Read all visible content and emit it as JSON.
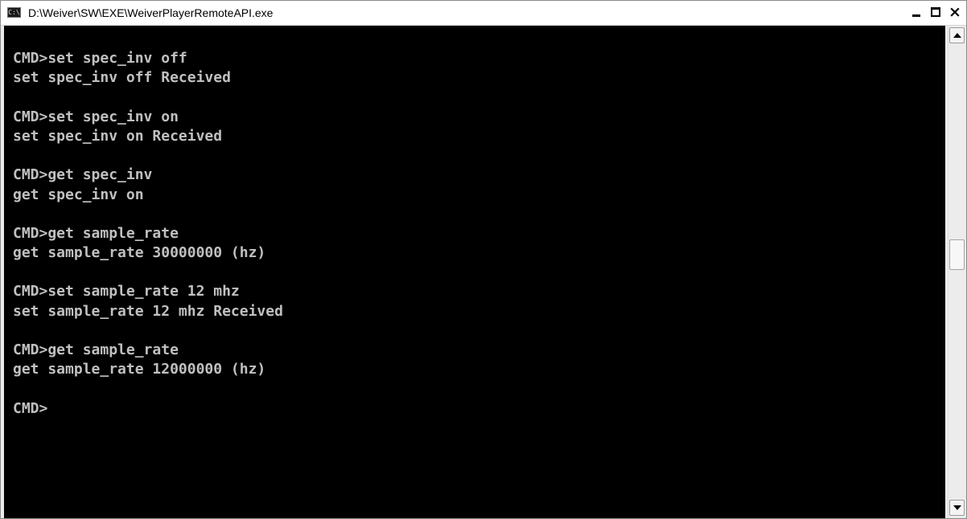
{
  "window": {
    "title": "D:\\Weiver\\SW\\EXE\\WeiverPlayerRemoteAPI.exe",
    "icon_name": "console-app-icon",
    "icon_glyph": "C:\\",
    "controls": {
      "minimize_icon": "minimize-icon",
      "maximize_icon": "maximize-icon",
      "close_icon": "close-icon",
      "close_glyph": "×"
    }
  },
  "console": {
    "background_color": "#000000",
    "text_color": "#c0c0c0",
    "lines": [
      "",
      "CMD>set spec_inv off",
      "set spec_inv off Received",
      "",
      "CMD>set spec_inv on",
      "set spec_inv on Received",
      "",
      "CMD>get spec_inv",
      "get spec_inv on",
      "",
      "CMD>get sample_rate",
      "get sample_rate 30000000 (hz)",
      "",
      "CMD>set sample_rate 12 mhz",
      "set sample_rate 12 mhz Received",
      "",
      "CMD>get sample_rate",
      "get sample_rate 12000000 (hz)",
      "",
      "CMD>"
    ]
  },
  "scrollbar": {
    "up_icon": "scroll-up-arrow-icon",
    "down_icon": "scroll-down-arrow-icon",
    "position_fraction": 0.4
  }
}
